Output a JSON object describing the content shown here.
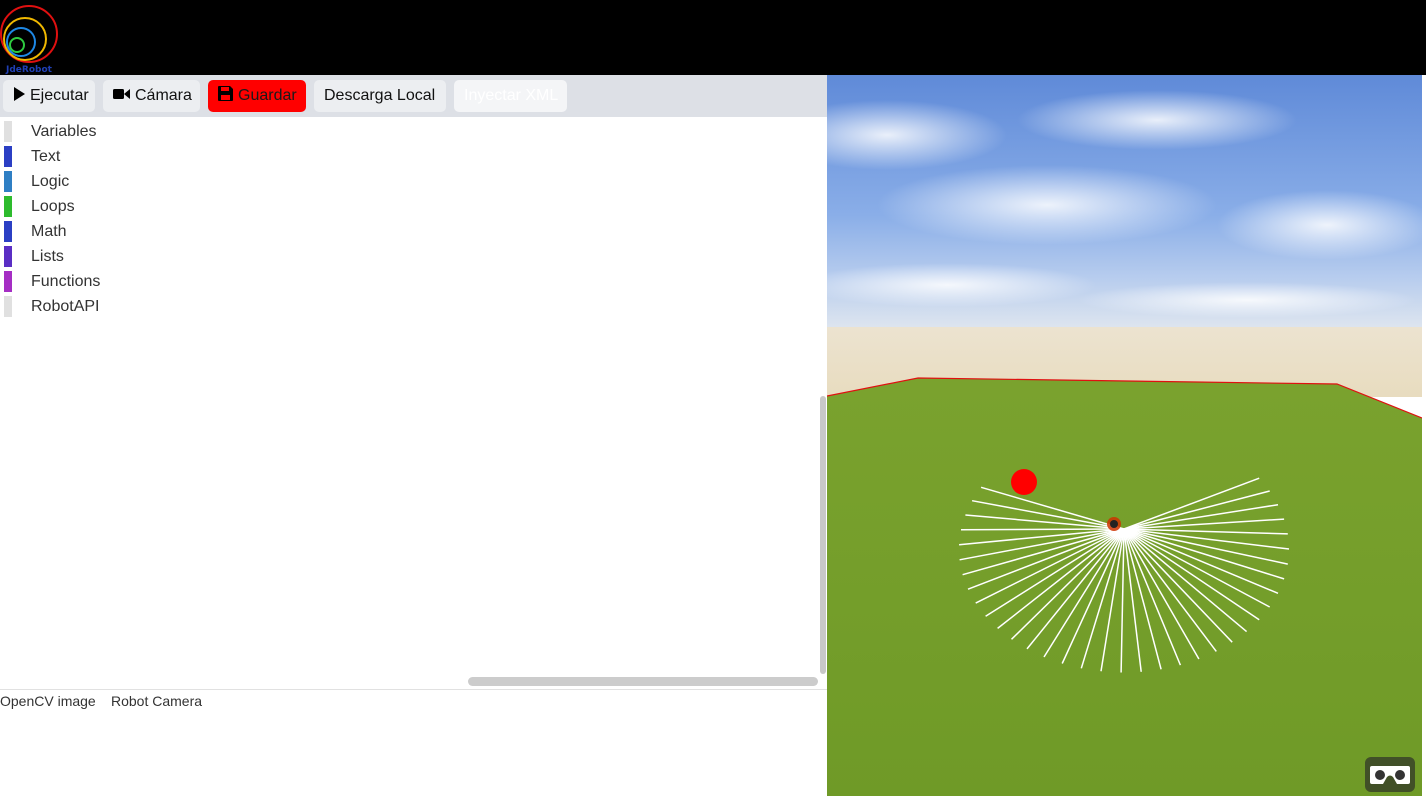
{
  "header": {
    "logo_text": "JdeRobot"
  },
  "toolbar": {
    "run_label": "Ejecutar",
    "camera_label": "Cámara",
    "save_label": "Guardar",
    "download_label": "Descarga Local",
    "inject_label": "Inyectar XML"
  },
  "toolbox": {
    "categories": [
      {
        "label": "Variables",
        "color": "#e0e0e0"
      },
      {
        "label": "Text",
        "color": "#2b3fc4"
      },
      {
        "label": "Logic",
        "color": "#2f7fc4"
      },
      {
        "label": "Loops",
        "color": "#2dbb2d"
      },
      {
        "label": "Math",
        "color": "#2b3fc4"
      },
      {
        "label": "Lists",
        "color": "#5a2ec4"
      },
      {
        "label": "Functions",
        "color": "#a52ec4"
      },
      {
        "label": "RobotAPI",
        "color": "#e0e0e0"
      }
    ]
  },
  "images": {
    "opencv_alt": "OpenCV image",
    "camera_alt": "Robot Camera"
  },
  "colors": {
    "save_button": "#ff0000",
    "header_bg": "#000000",
    "toolbar_bg": "#dde0e6",
    "ground": "#7aa22e",
    "ball": "#ff0000"
  },
  "icons": {
    "run": "play-icon",
    "camera": "video-camera-icon",
    "save": "floppy-disk-icon",
    "vr": "vr-goggles-icon"
  }
}
